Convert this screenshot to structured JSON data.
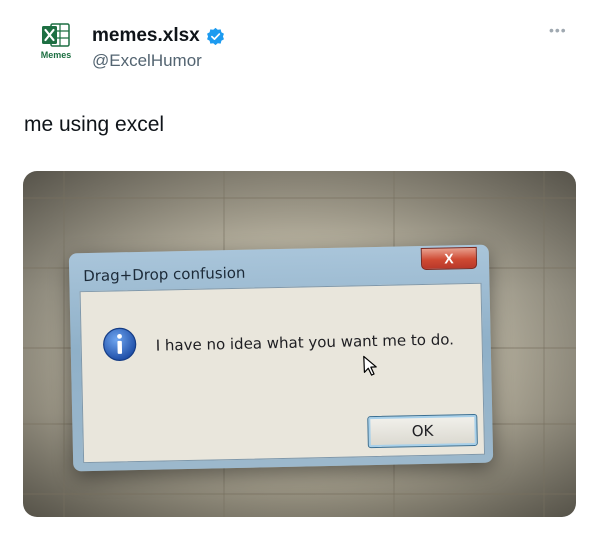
{
  "tweet": {
    "avatar_label": "Memes",
    "display_name": "memes.xlsx",
    "handle": "@ExcelHumor",
    "more_icon": "more-horizontal-icon",
    "text": "me using excel"
  },
  "photo": {
    "dialog": {
      "title": "Drag+Drop confusion",
      "close_label": "X",
      "message": "I have no idea what you want me to do.",
      "ok_label": "OK",
      "icon": "info-icon"
    }
  },
  "colors": {
    "excel_green": "#1d6f42",
    "verified_blue": "#1d9bf0",
    "handle_gray": "#536471"
  }
}
